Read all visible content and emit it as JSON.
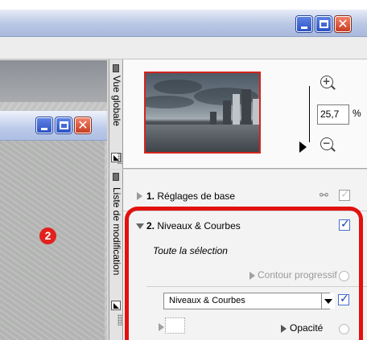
{
  "outer_window": {
    "minimize": "minimize",
    "maximize": "maximize",
    "close": "close"
  },
  "doc_window": {
    "minimize": "minimize",
    "maximize": "maximize",
    "close": "close"
  },
  "annotation": {
    "marker": "2"
  },
  "overview": {
    "tab_label": "Vue globale",
    "zoom_value": "25,7",
    "zoom_unit": "%",
    "zoom_in_icon": "zoom-in-icon",
    "zoom_out_icon": "zoom-out-icon"
  },
  "modification_list": {
    "tab_label": "Liste de modification",
    "steps": [
      {
        "number": "1.",
        "label": "Réglages de base",
        "checked": true,
        "enabled": false
      },
      {
        "number": "2.",
        "label": "Niveaux & Courbes",
        "checked": true,
        "enabled": true
      }
    ],
    "selection_label": "Toute la sélection",
    "feather_label": "Contour progressif",
    "tool_select": "Niveaux & Courbes",
    "opacity_label": "Opacité"
  },
  "colors": {
    "highlight": "#e2110e",
    "marker": "#e2211c",
    "thumbnail_border": "#d4241e"
  }
}
